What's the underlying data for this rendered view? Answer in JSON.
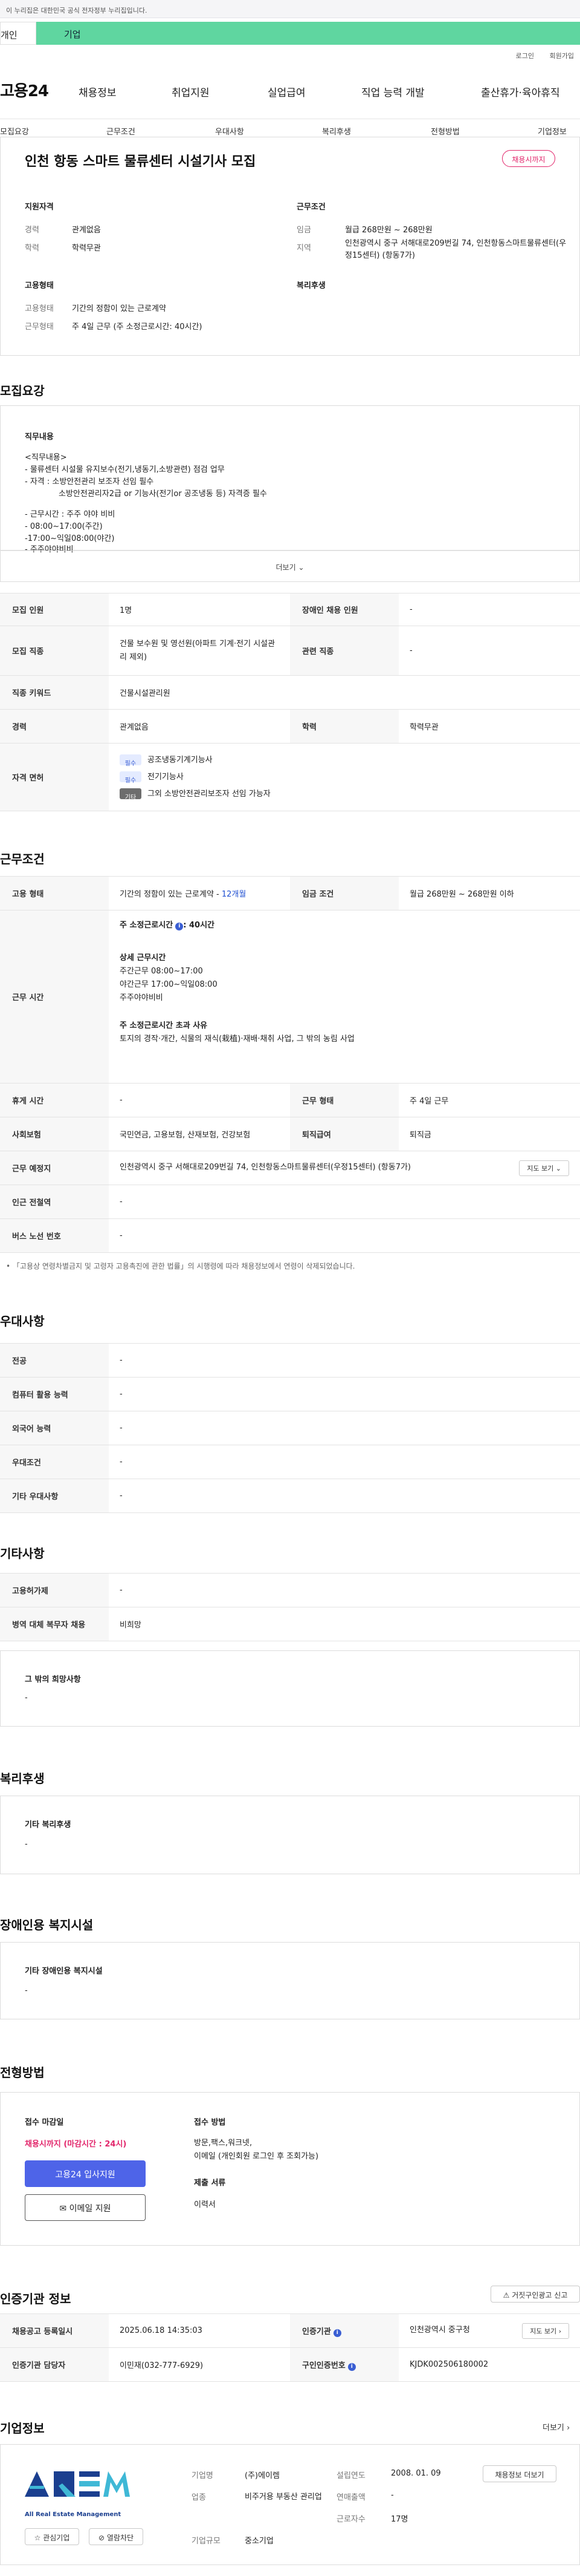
{
  "gov_notice": "이 누리집은 대한민국 공식 전자정부 누리집입니다.",
  "user_tabs": {
    "personal": "개인",
    "company": "기업"
  },
  "util_menu": [
    "로그인",
    "회원가입"
  ],
  "gnb": {
    "logo": "고용24",
    "items": [
      "채용정보",
      "취업지원",
      "실업급여",
      "직업 능력 개발",
      "출산휴가·육아휴직"
    ]
  },
  "sub_nav": [
    "모집요강",
    "근무조건",
    "우대사항",
    "복리후생",
    "전형방법",
    "기업정보"
  ],
  "summary": {
    "title": "인천 항동 스마트 물류센터 시설기사 모집",
    "badge": "채용시까지",
    "qualification_head": "지원자격",
    "career_label": "경력",
    "career_value": "관계없음",
    "edu_label": "학력",
    "edu_value": "학력무관",
    "employ_head": "고용형태",
    "type_label": "고용형태",
    "type_value": "기간의 정함이 있는 근로계약",
    "worktype_label": "근무형태",
    "worktype_value": "주 4일 근무 (주 소정근로시간: 40시간)",
    "cond_head": "근무조건",
    "wage_label": "임금",
    "wage_value": "월급 268만원 ~ 268만원",
    "area_label": "지역",
    "area_value": "인천광역시 중구 서해대로209번길 74, 인천항동스마트물류센터(우정15센터) (항동7가)",
    "welfare_head": "복리후생"
  },
  "recruit": {
    "heading": "모집요강",
    "duty_head": "직무내용",
    "duty_lines": [
      "<직무내용>",
      "- 물류센터 시설물 유지보수(전기,냉동기,소방관련) 점검 업무",
      "- 자격 : 소방안전관리 보조자 선임 필수",
      "소방안전관리자2급 or 기능사(전기or 공조냉동 등) 자격증 필수",
      "- 근무시간 : 주주 야야 비비",
      "- 08:00~17:00(주간)",
      "-17:00~익일08:00(야간)",
      "- 주주야야비비"
    ],
    "more": "더보기",
    "rows": {
      "count_label": "모집 인원",
      "count_value": "1명",
      "disabled_label": "장애인 채용 인원",
      "disabled_value": "-",
      "job_label": "모집 직종",
      "job_value": "건물 보수원 및 영선원(아파트 기계·전기 시설관리 제외)",
      "related_label": "관련 직종",
      "related_value": "-",
      "keyword_label": "직종 키워드",
      "keyword_value": "건물시설관리원",
      "career_label": "경력",
      "career_value": "관계없음",
      "edu_label": "학력",
      "edu_value": "학력무관",
      "license_label": "자격 면허",
      "licenses": [
        {
          "tag": "필수",
          "name": "공조냉동기계기능사"
        },
        {
          "tag": "필수",
          "name": "전기기능사"
        },
        {
          "tag": "기타",
          "name": "그외 소방안전관리보조자 선임 가능자"
        }
      ]
    }
  },
  "conditions": {
    "heading": "근무조건",
    "emp_type_label": "고용 형태",
    "emp_type_value": "기간의 정함이 있는 근로계약 - ",
    "emp_type_months": "12개월",
    "wage_label": "임금 조건",
    "wage_value": "월급 268만원 ~ 268만원 이하",
    "hours_label": "근무 시간",
    "hours_main": "주 소정근로시간",
    "hours_main_value": ": 40시간",
    "detail_head": "상세 근무시간",
    "detail_lines": [
      "주간근무 08:00~17:00",
      "야간근무 17:00~익일08:00",
      "주주야야비비"
    ],
    "over_head": "주 소정근로시간 초과 사유",
    "over_value": "토지의 경작·개간, 식물의 재식(栽植)·재배·채취 사업, 그 밖의 농림 사업",
    "break_label": "휴게 시간",
    "break_value": "-",
    "shift_label": "근무 형태",
    "shift_value": "주 4일 근무",
    "insurance_label": "사회보험",
    "insurance_value": "국민연금, 고용보험, 산재보험, 건강보험",
    "retire_label": "퇴직급여",
    "retire_value": "퇴직금",
    "place_label": "근무 예정지",
    "place_value": "인천광역시 중구 서해대로209번길 74, 인천항동스마트물류센터(우정15센터) (항동7가)",
    "map_btn": "지도 보기",
    "subway_label": "인근 전철역",
    "subway_value": "-",
    "bus_label": "버스 노선 번호",
    "bus_value": "-",
    "notice": "「고용상 연령차별금지 및 고령자 고용촉진에 관한 법률」의 시행령에 따라 채용정보에서 연령이 삭제되었습니다."
  },
  "preference": {
    "heading": "우대사항",
    "rows": [
      {
        "label": "전공",
        "value": "-"
      },
      {
        "label": "컴퓨터 활용 능력",
        "value": "-"
      },
      {
        "label": "외국어 능력",
        "value": "-"
      },
      {
        "label": "우대조건",
        "value": "-"
      },
      {
        "label": "기타 우대사항",
        "value": "-"
      }
    ]
  },
  "other": {
    "heading": "기타사항",
    "rows": [
      {
        "label": "고용허가제",
        "value": "-"
      },
      {
        "label": "병역 대체 복무자 채용",
        "value": "비희망"
      }
    ],
    "extra_head": "그 밖의 희망사항",
    "extra_value": "-"
  },
  "welfare": {
    "heading": "복리후생",
    "head": "기타 복리후생",
    "value": "-"
  },
  "disabled": {
    "heading": "장애인용 복지시설",
    "head": "기타 장애인용 복지시설",
    "value": "-"
  },
  "process": {
    "heading": "전형방법",
    "deadline_head": "접수 마감일",
    "deadline_value": "채용시까지 (마감시간 : 24시)",
    "apply_btn": "고용24 입사지원",
    "email_btn": "이메일 지원",
    "method_head": "접수 방법",
    "method_value": "방문,팩스,워크넷,",
    "method_value2": "이메일 (개인회원 로그인 후 조회가능)",
    "docs_head": "제출 서류",
    "docs_value": "이력서"
  },
  "agency": {
    "heading": "인증기관 정보",
    "report_btn": "거짓구인광고 신고",
    "reg_label": "채용공고 등록일시",
    "reg_value": "2025.06.18 14:35:03",
    "org_label": "인증기관",
    "org_value": "인천광역시 중구청",
    "map_btn": "지도 보기",
    "manager_label": "인증기관 담당자",
    "manager_value": "이민재(032-777-6929)",
    "num_label": "구인인증번호",
    "num_value": "KJDK002506180002"
  },
  "company": {
    "heading": "기업정보",
    "more": "더보기",
    "logo_text": "AREM",
    "logo_sub": "All Real Estate Management",
    "fav_btn": "관심기업",
    "block_btn": "열람차단",
    "name_label": "기업명",
    "name_value": "(주)에이렘",
    "industry_label": "업종",
    "industry_value": "비주거용 부동산 관리업",
    "scale_label": "기업규모",
    "scale_value": "중소기업",
    "founded_label": "설립연도",
    "founded_value": "2008. 01. 09",
    "sales_label": "연매출액",
    "sales_value": "-",
    "staff_label": "근로자수",
    "staff_value": "17명",
    "jobs_btn": "채용정보 더보기"
  },
  "colors": {
    "brand_green": "#5fd6a0",
    "accent_blue": "#4e64e8",
    "accent_pink": "#e2266b"
  }
}
